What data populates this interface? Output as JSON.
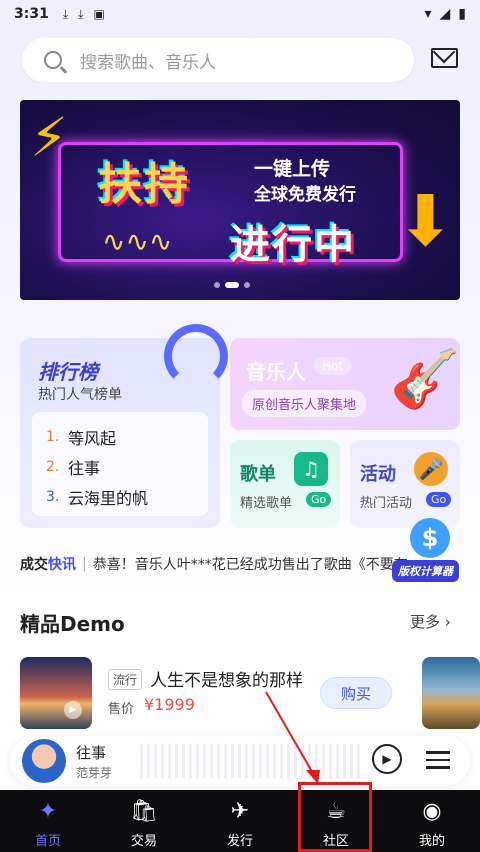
{
  "status_bar": {
    "time": "3:31",
    "icons": [
      "download-icon",
      "download-icon",
      "app-icon"
    ],
    "right_icons": [
      "wifi-icon",
      "signal-icon",
      "battery-icon"
    ]
  },
  "search": {
    "placeholder": "搜索歌曲、音乐人"
  },
  "banner": {
    "headline_1": "扶持",
    "headline_2": "进行中",
    "sub_1": "一键上传",
    "sub_2": "全球免费发行",
    "dots": 3,
    "active_dot": 1
  },
  "rank_card": {
    "title": "排行榜",
    "subtitle": "热门人气榜单",
    "items": [
      {
        "num": "1.",
        "title": "等风起",
        "color": "#f2762e"
      },
      {
        "num": "2.",
        "title": "往事",
        "color": "#f2762e"
      },
      {
        "num": "3.",
        "title": "云海里的帆",
        "color": "#3f51ff"
      }
    ]
  },
  "musician_card": {
    "title": "音乐人",
    "badge": "Hot",
    "subtitle": "原创音乐人聚集地"
  },
  "playlist_card": {
    "title": "歌单",
    "subtitle": "精选歌单",
    "go": "Go"
  },
  "events_card": {
    "title": "活动",
    "subtitle": "热门活动",
    "go": "Go"
  },
  "ticker": {
    "label_1": "成交",
    "label_2": "快讯",
    "separator": "|",
    "message": "恭喜！音乐人叶***花已经成功售出了歌曲《不要在"
  },
  "calculator": {
    "label": "版权计算器",
    "symbol": "$"
  },
  "demo_section": {
    "title": "精品Demo",
    "more": "更多 ›"
  },
  "demo_item": {
    "genre": "流行",
    "title": "人生不是想象的那样",
    "price_label": "售价",
    "price": "¥1999",
    "buy": "购买"
  },
  "player": {
    "title": "往事",
    "artist": "范芽芽"
  },
  "tabs": [
    {
      "label": "首页",
      "icon": "home-icon",
      "active": true
    },
    {
      "label": "交易",
      "icon": "bag-icon",
      "active": false
    },
    {
      "label": "发行",
      "icon": "send-icon",
      "active": false
    },
    {
      "label": "社区",
      "icon": "community-icon",
      "active": false
    },
    {
      "label": "我的",
      "icon": "profile-icon",
      "active": false
    }
  ],
  "colors": {
    "accent": "#3f51ff",
    "highlight": "#e51b1b",
    "price": "#f04a4a"
  }
}
